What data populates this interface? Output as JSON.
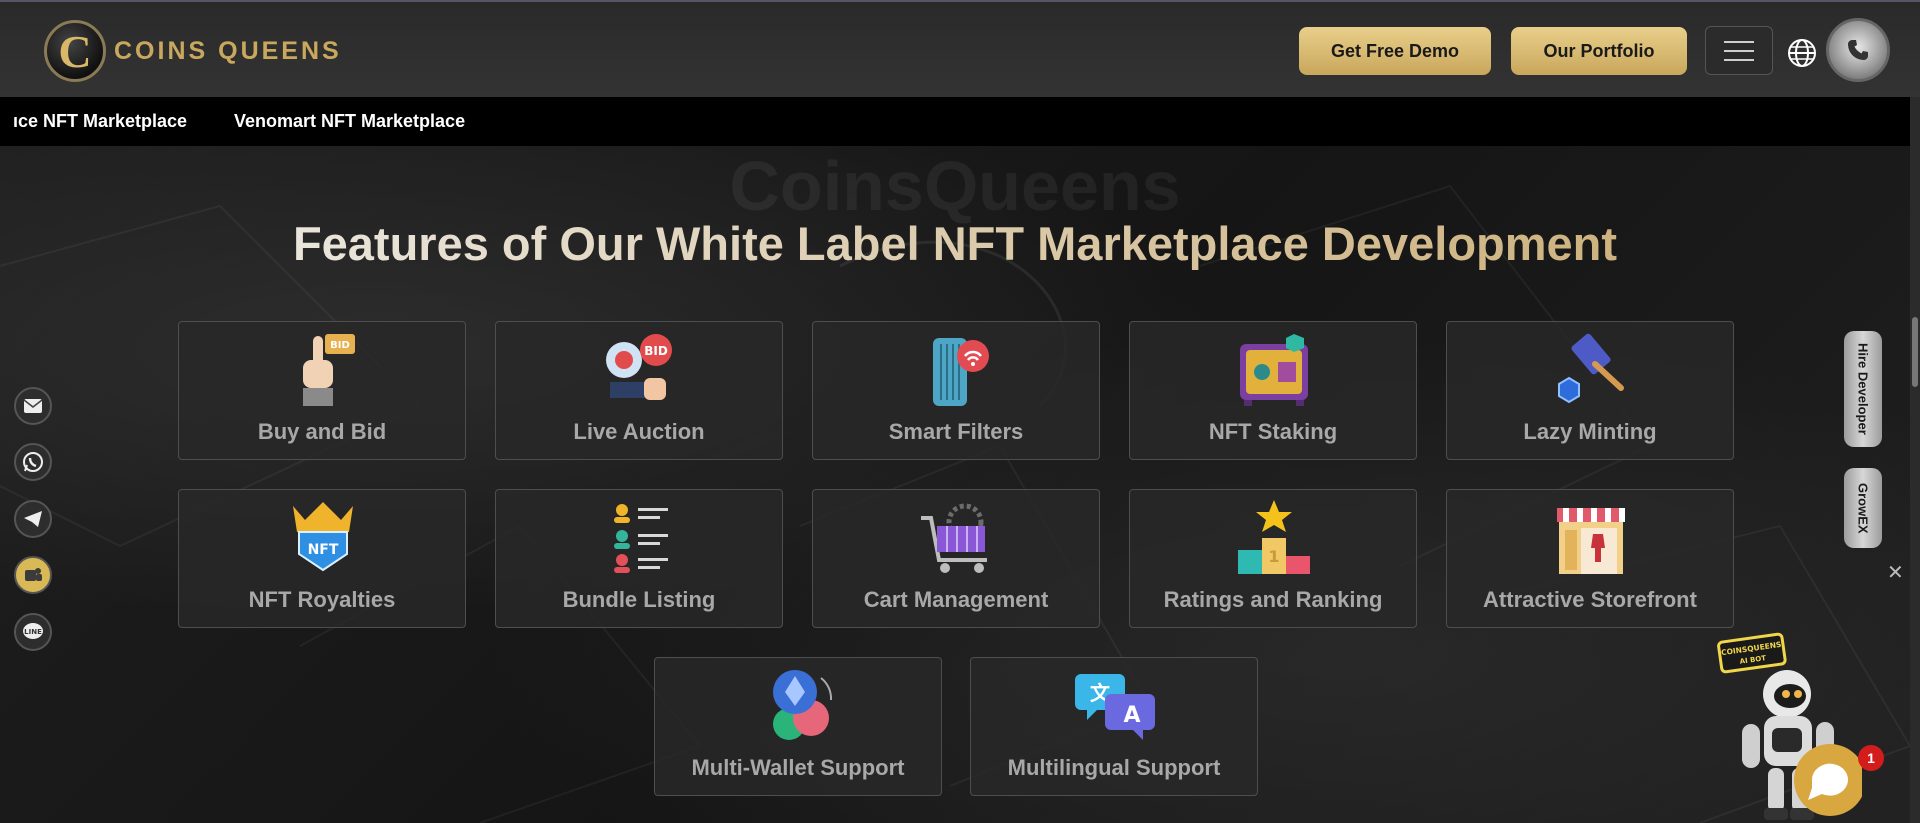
{
  "header": {
    "logo_letter": "C",
    "logo_text": "COINS QUEENS",
    "demo_button": "Get Free Demo",
    "portfolio_button": "Our Portfolio"
  },
  "marquee": {
    "items": [
      "ıce NFT Marketplace",
      "Venomart NFT Marketplace"
    ]
  },
  "section": {
    "watermark": "CoinsQueens",
    "heading": "Features of Our White Label NFT Marketplace Development"
  },
  "features": [
    {
      "label": "Buy and Bid",
      "icon": "bid-hand-icon"
    },
    {
      "label": "Live Auction",
      "icon": "auction-bell-icon"
    },
    {
      "label": "Smart Filters",
      "icon": "smart-filter-icon"
    },
    {
      "label": "NFT Staking",
      "icon": "safe-vault-icon"
    },
    {
      "label": "Lazy Minting",
      "icon": "gavel-icon"
    },
    {
      "label": "NFT Royalties",
      "icon": "crown-nft-icon"
    },
    {
      "label": "Bundle Listing",
      "icon": "list-users-icon"
    },
    {
      "label": "Cart Management",
      "icon": "shopping-cart-icon"
    },
    {
      "label": "Ratings and Ranking",
      "icon": "podium-star-icon"
    },
    {
      "label": "Attractive Storefront",
      "icon": "storefront-icon"
    },
    {
      "label": "Multi-Wallet Support",
      "icon": "crypto-coins-icon"
    },
    {
      "label": "Multilingual Support",
      "icon": "translate-icon"
    }
  ],
  "side_tabs": {
    "hire": "Hire Developer",
    "growex": "GrowEX"
  },
  "chat": {
    "robot_sign": "COINSQUEENS AI BOT",
    "badge_count": "1"
  },
  "colors": {
    "gold": "#c9a75c",
    "heading_gradient_start": "#f0f0f0",
    "heading_gradient_end": "#c7a76a",
    "card_bg": "#282828",
    "badge_red": "#d31d1d"
  }
}
